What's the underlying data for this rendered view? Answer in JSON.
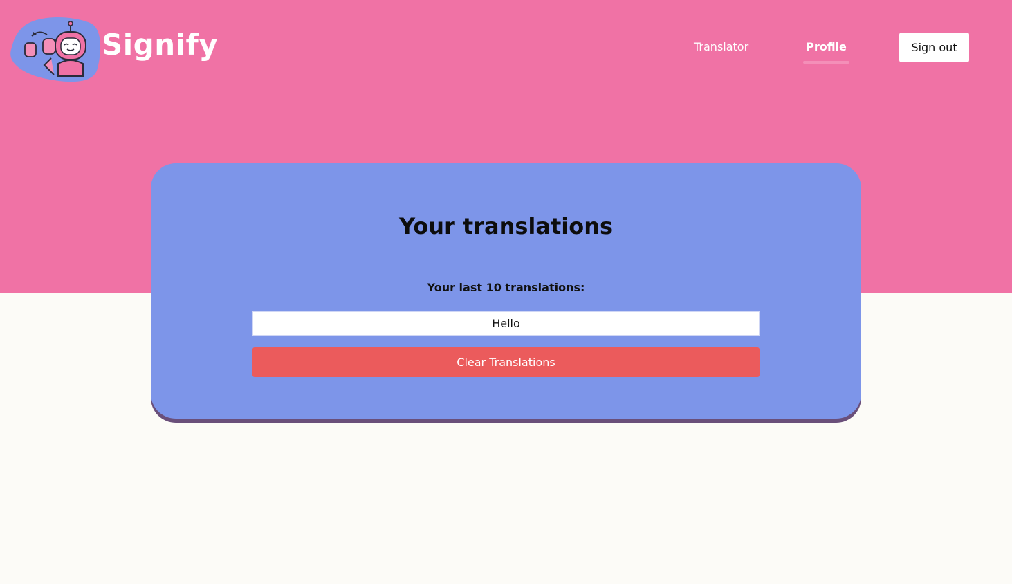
{
  "brand": {
    "name": "Signify",
    "logo_icon": "robot-signing-icon"
  },
  "nav": {
    "links": [
      {
        "label": "Translator",
        "active": false
      },
      {
        "label": "Profile",
        "active": true
      }
    ],
    "signout_label": "Sign out"
  },
  "profile": {
    "title": "Your translations",
    "subtitle": "Your last 10 translations:",
    "translations": [
      "Hello"
    ],
    "clear_label": "Clear Translations"
  },
  "colors": {
    "header_bg": "#f072a5",
    "card_bg": "#7d95e9",
    "danger": "#eb5b5c",
    "page_bg": "#fcfbf7"
  }
}
